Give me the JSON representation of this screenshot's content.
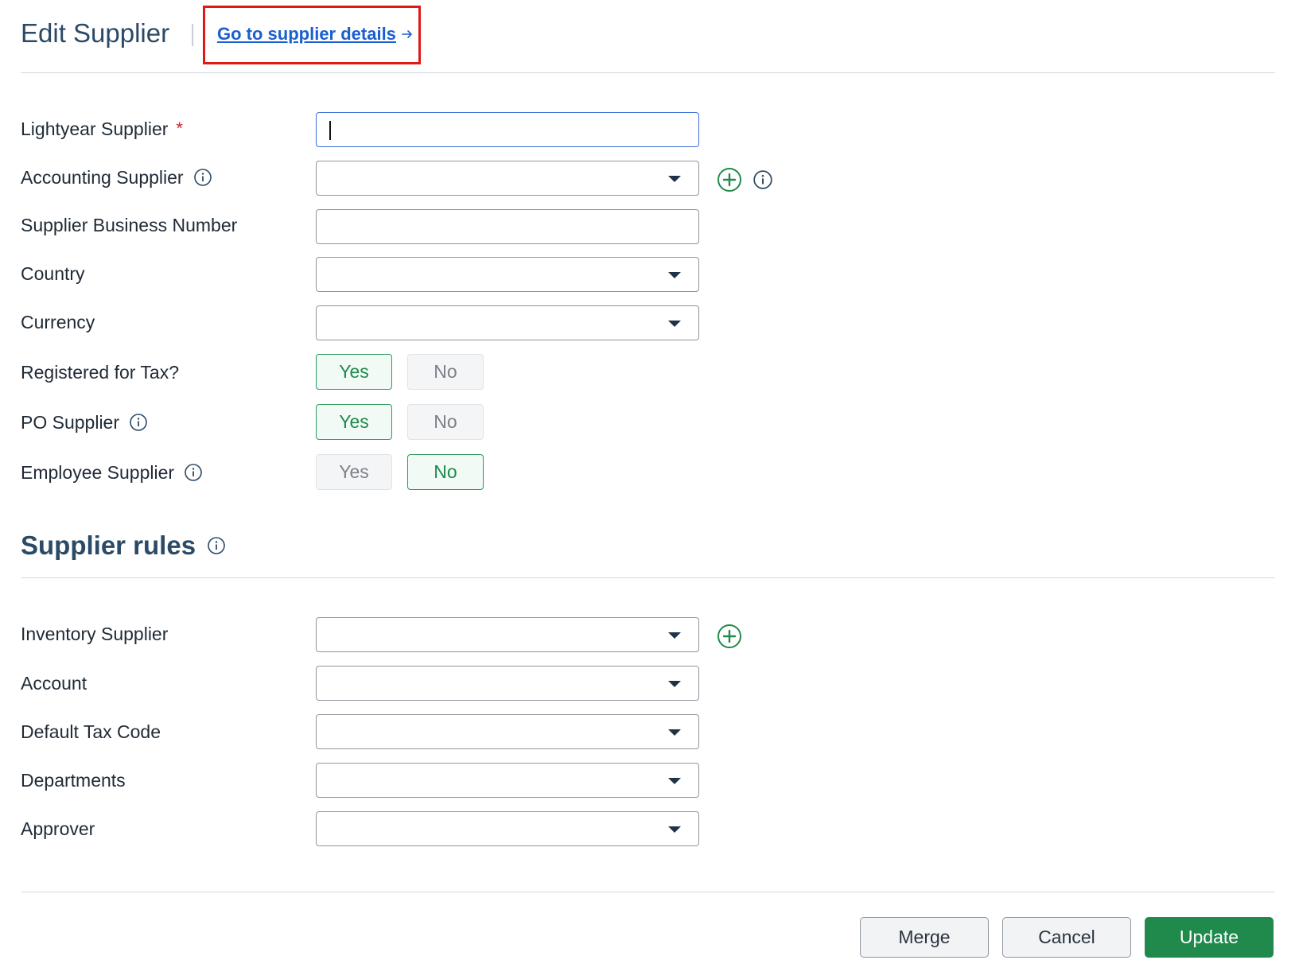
{
  "header": {
    "title": "Edit Supplier",
    "details_link": "Go to supplier details",
    "details_link_arrow": "arrow-right-icon"
  },
  "fields": {
    "lightyear_supplier": {
      "label": "Lightyear Supplier",
      "required_mark": "*",
      "value": ""
    },
    "accounting_supplier": {
      "label": "Accounting Supplier",
      "value": ""
    },
    "business_number": {
      "label": "Supplier Business Number",
      "value": ""
    },
    "country": {
      "label": "Country",
      "value": ""
    },
    "currency": {
      "label": "Currency",
      "value": ""
    },
    "registered_for_tax": {
      "label": "Registered for Tax?",
      "yes": "Yes",
      "no": "No",
      "selected": "Yes"
    },
    "po_supplier": {
      "label": "PO Supplier",
      "yes": "Yes",
      "no": "No",
      "selected": "Yes"
    },
    "employee_supplier": {
      "label": "Employee Supplier",
      "yes": "Yes",
      "no": "No",
      "selected": "No"
    }
  },
  "supplier_rules": {
    "title": "Supplier rules",
    "inventory_supplier": {
      "label": "Inventory Supplier",
      "value": ""
    },
    "account": {
      "label": "Account",
      "value": ""
    },
    "default_tax_code": {
      "label": "Default Tax Code",
      "value": ""
    },
    "departments": {
      "label": "Departments",
      "value": ""
    },
    "approver": {
      "label": "Approver",
      "value": ""
    }
  },
  "actions": {
    "merge": "Merge",
    "cancel": "Cancel",
    "update": "Update"
  },
  "colors": {
    "title": "#2b4a66",
    "link": "#1a5fd0",
    "highlight": "#e01818",
    "accent_green": "#1f8a4c",
    "required": "#d0202a"
  }
}
